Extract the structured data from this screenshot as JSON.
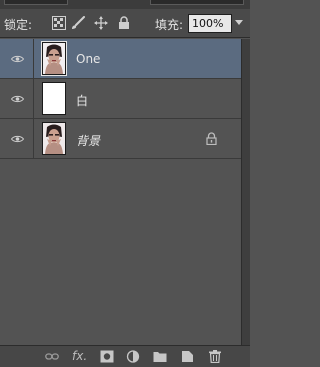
{
  "lock_bar": {
    "lock_label": "锁定:",
    "fill_label": "填充:",
    "fill_value": "100%",
    "lock_icons": [
      "lock-transparent-pixels-icon",
      "lock-image-pixels-icon",
      "lock-position-icon",
      "lock-all-icon"
    ]
  },
  "layers": [
    {
      "name": "One",
      "selected": true,
      "visible": true,
      "thumbnail": "portrait-thumbnail",
      "locked": false
    },
    {
      "name": "白",
      "selected": false,
      "visible": true,
      "thumbnail": "white-fill-thumbnail",
      "locked": false
    },
    {
      "name": "背景",
      "selected": false,
      "visible": true,
      "thumbnail": "portrait-thumbnail",
      "locked": true
    }
  ],
  "bottom_bar": {
    "icons": [
      "link-layers-icon",
      "layer-style-fx-icon",
      "add-mask-icon",
      "adjustment-layer-icon",
      "new-group-folder-icon",
      "new-layer-icon",
      "delete-layer-trash-icon"
    ],
    "fx_label": "fx."
  },
  "colors": {
    "panel_bg": "#535353",
    "selected_row": "#5b6b80",
    "bar_bg": "#4a4a4a"
  }
}
